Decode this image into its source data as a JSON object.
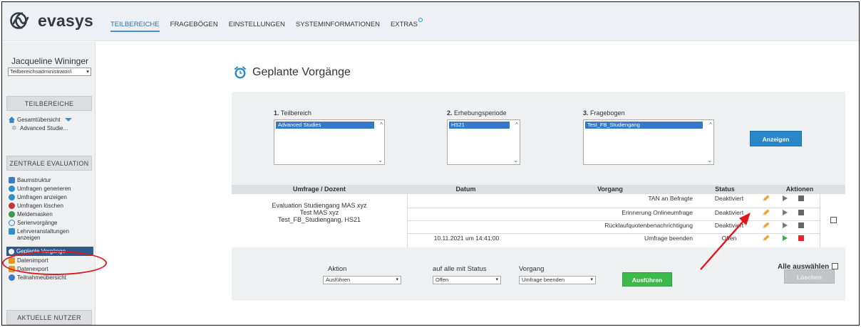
{
  "brand": {
    "logo_text": "evasys"
  },
  "nav": {
    "items": [
      {
        "label": "TEILBEREICHE",
        "active": true
      },
      {
        "label": "FRAGEBÖGEN"
      },
      {
        "label": "EINSTELLUNGEN"
      },
      {
        "label": "SYSTEMINFORMATIONEN"
      },
      {
        "label": "EXTRAS"
      }
    ]
  },
  "sidebar": {
    "user_name": "Jacqueline Wininger",
    "role": "Teilbereichsadministrator/i",
    "sections": [
      {
        "title": "TEILBEREICHE"
      },
      {
        "title": "ZENTRALE EVALUATION"
      },
      {
        "title": "AKTUELLE NUTZER"
      }
    ],
    "tree": {
      "overview": "Gesamtübersicht",
      "child": "Advanced Studie..."
    },
    "items": [
      {
        "label": "Baumstruktur",
        "icon": "tree-icon",
        "color": "#3a7bc8"
      },
      {
        "label": "Umfragen generieren",
        "icon": "survey-generate-icon",
        "color": "#2f8fc9"
      },
      {
        "label": "Umfragen anzeigen",
        "icon": "survey-view-icon",
        "color": "#2f8fc9"
      },
      {
        "label": "Umfragen löschen",
        "icon": "survey-delete-icon",
        "color": "#c23636"
      },
      {
        "label": "Meldemasken",
        "icon": "report-mask-icon",
        "color": "#3a9a4a"
      },
      {
        "label": "Serienvorgänge",
        "icon": "series-icon",
        "color": "#3a7bc8"
      },
      {
        "label": "Lehrveranstaltungen anzeigen",
        "icon": "courses-icon",
        "color": "#2f8fc9"
      },
      {
        "label": "Geplante Vorgänge",
        "icon": "clock-icon",
        "color": "#ffffff",
        "active": true
      },
      {
        "label": "Datenimport",
        "icon": "import-icon",
        "color": "#e09a2a"
      },
      {
        "label": "Datenexport",
        "icon": "export-icon",
        "color": "#e09a2a"
      },
      {
        "label": "Teilnahmeübersicht",
        "icon": "participation-icon",
        "color": "#3a7bc8"
      }
    ]
  },
  "main": {
    "title": "Geplante Vorgänge",
    "filters": [
      {
        "num": "1.",
        "label": "Teilbereich",
        "selected": "Advanced Studies"
      },
      {
        "num": "2.",
        "label": "Erhebungsperiode",
        "selected": "HS21"
      },
      {
        "num": "3.",
        "label": "Fragebogen",
        "selected": "Test_FB_Studiengang"
      }
    ],
    "show_button": "Anzeigen",
    "table": {
      "headers": [
        "Umfrage / Dozent",
        "Datum",
        "Vorgang",
        "Status",
        "Aktionen"
      ],
      "survey_lines": [
        "Evaluation Studiengang MAS xyz",
        "Test MAS xyz",
        "Test_FB_Studiengang, HS21"
      ],
      "rows": [
        {
          "date": "",
          "process": "TAN an Befragte",
          "status": "Deaktiviert"
        },
        {
          "date": "",
          "process": "Erinnerung Onlineumfrage",
          "status": "Deaktiviert"
        },
        {
          "date": "",
          "process": "Rücklaufquotenbenachrichtigung",
          "status": "Deaktiviert"
        },
        {
          "date": "10.11.2021 um 14:41:00",
          "process": "Umfrage beenden",
          "status": "Offen"
        }
      ]
    },
    "bulk": {
      "action_label": "Aktion",
      "action_value": "Ausführen",
      "status_label": "auf alle mit Status",
      "status_value": "Offen",
      "process_label": "Vorgang",
      "process_value": "Umfrage beenden",
      "execute_button": "Ausführen",
      "select_all": "Alle auswählen",
      "delete_button": "Löschen"
    }
  },
  "colors": {
    "accent": "#2a87c7",
    "success": "#3bba4a",
    "danger": "#e2252b",
    "annotation": "#e0161e"
  }
}
